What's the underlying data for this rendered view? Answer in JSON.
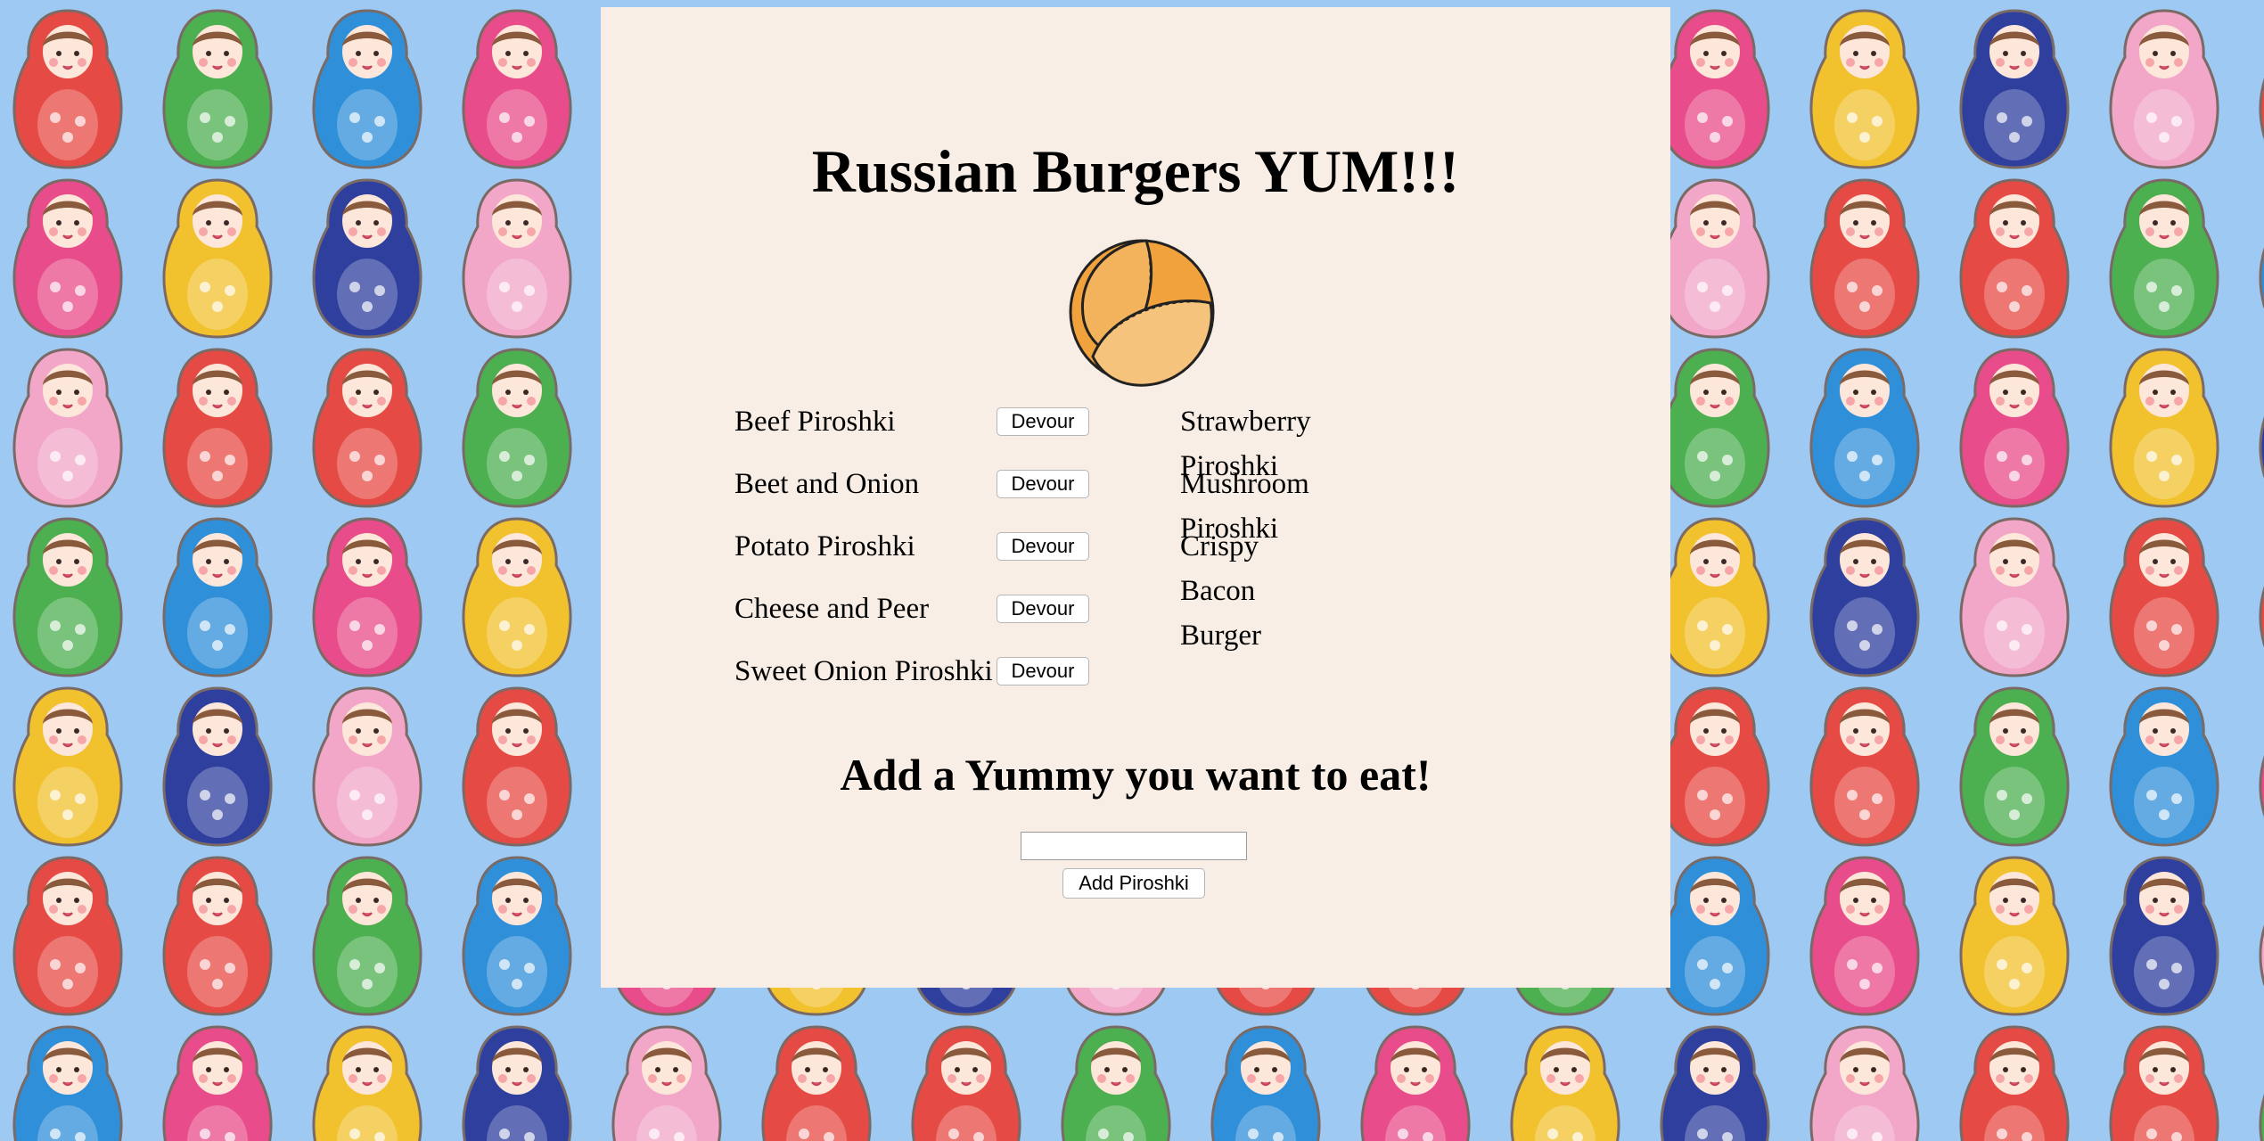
{
  "page": {
    "title": "Russian Burgers YUM!!!",
    "background_color": "#9ec9f2",
    "panel_color": "#f8eee5"
  },
  "logo": {
    "icon": "piroshki-icon"
  },
  "uneaten": [
    {
      "name": "Beef Piroshki",
      "button": "Devour"
    },
    {
      "name": "Beet and Onion",
      "button": "Devour"
    },
    {
      "name": "Potato Piroshki",
      "button": "Devour"
    },
    {
      "name": "Cheese and Peer",
      "button": "Devour"
    },
    {
      "name": "Sweet Onion Piroshki",
      "button": "Devour"
    }
  ],
  "eaten": [
    {
      "name": "Strawberry Piroshki"
    },
    {
      "name": "Mushroom Piroshki"
    },
    {
      "name": "Crispy Bacon Burger"
    }
  ],
  "add_form": {
    "heading": "Add a Yummy you want to eat!",
    "input_value": "",
    "input_placeholder": "",
    "button_label": "Add Piroshki"
  },
  "background_pattern": {
    "icon": "matryoshka-doll-icon"
  }
}
